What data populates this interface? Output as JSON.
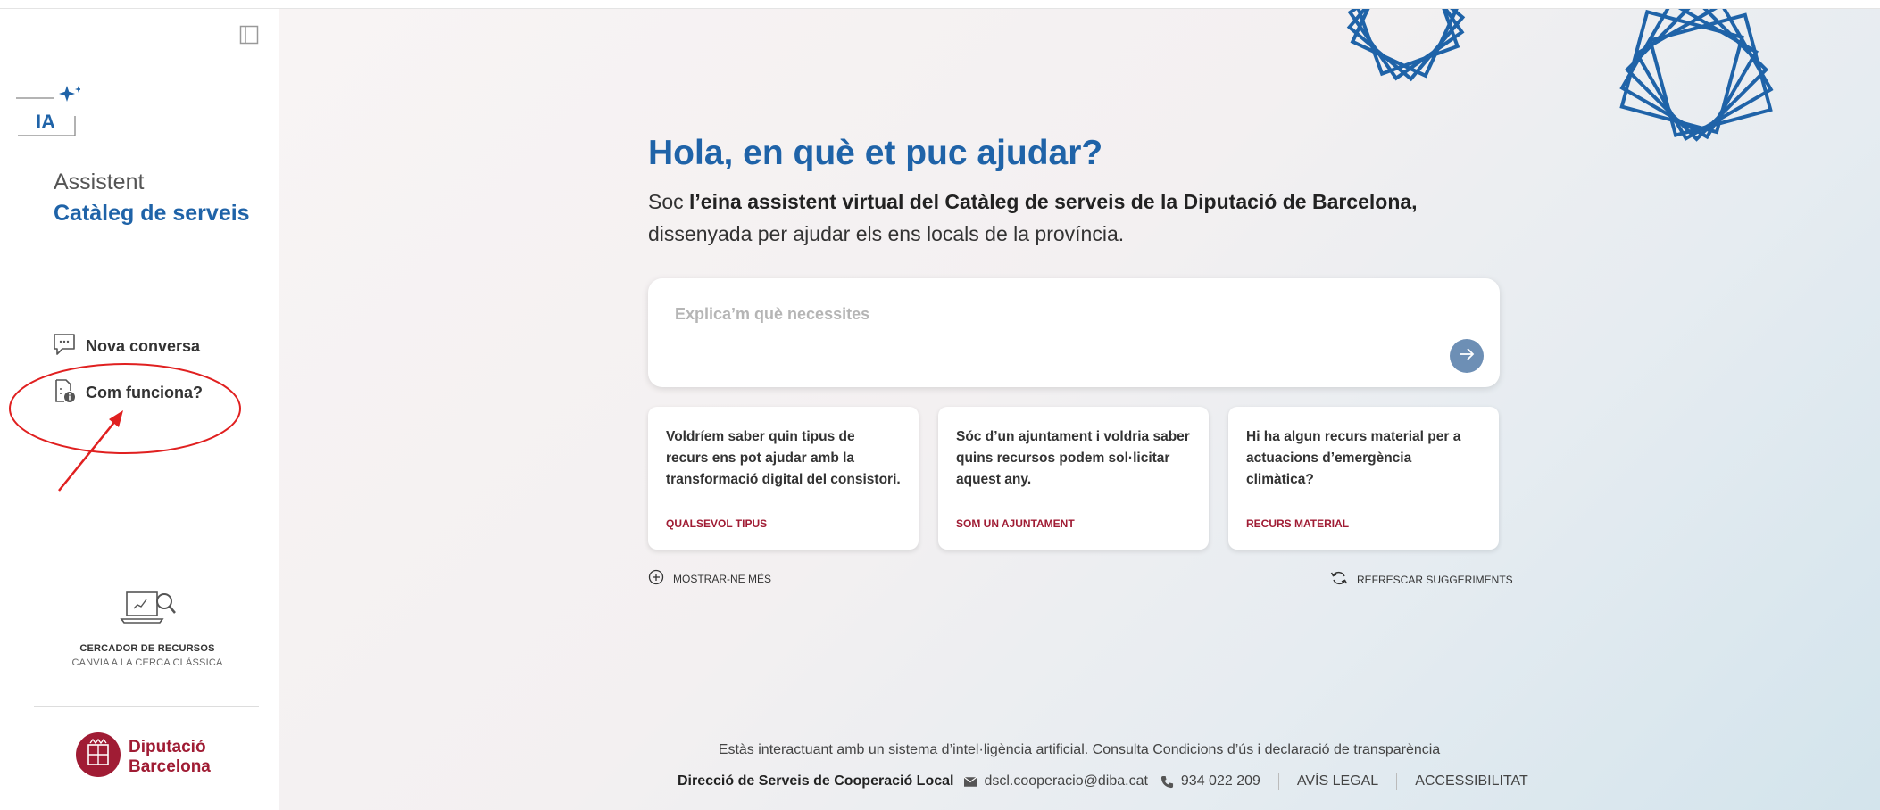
{
  "sidebar": {
    "logo_text": "IA",
    "assistant_label": "Assistent",
    "catalog_label": "Catàleg de serveis",
    "items": [
      {
        "label": "Nova conversa",
        "icon": "chat-bubble-icon"
      },
      {
        "label": "Com funciona?",
        "icon": "document-info-icon"
      }
    ],
    "search_tool": {
      "title": "CERCADOR DE RECURSOS",
      "subtitle": "CANVIA A LA CERCA CLÀSSICA",
      "icon": "laptop-search-icon"
    },
    "org_logo": {
      "line1": "Diputació",
      "line2": "Barcelona"
    }
  },
  "hero": {
    "title": "Hola, en què et puc ajudar?",
    "subtitle_prefix": "Soc ",
    "subtitle_bold": "l’eina assistent virtual del Catàleg de serveis de la Diputació de Barcelona,",
    "subtitle_rest": "dissenyada per ajudar els ens locals de la província."
  },
  "chat": {
    "placeholder": "Explica’m què necessites",
    "send_icon": "arrow-right-icon"
  },
  "suggestions": [
    {
      "question": "Voldríem saber quin tipus de recurs ens pot ajudar amb la transformació digital del consistori.",
      "tag": "QUALSEVOL TIPUS"
    },
    {
      "question": "Sóc d’un ajuntament i voldria saber quins recursos podem sol·licitar aquest any.",
      "tag": "SOM UN AJUNTAMENT"
    },
    {
      "question": "Hi ha algun recurs material per a actuacions d’emergència climàtica?",
      "tag": "RECURS MATERIAL"
    }
  ],
  "actions": {
    "show_more": "MOSTRAR-NE MÉS",
    "refresh": "REFRESCAR SUGGERIMENTS"
  },
  "footer": {
    "notice": "Estàs interactuant amb un sistema d’intel·ligència artificial. Consulta Condicions d’ús i declaració de transparència",
    "org": "Direcció de Serveis de Cooperació Local",
    "email": "dscl.cooperacio@diba.cat",
    "phone": "934 022 209",
    "legal": "AVÍS LEGAL",
    "accessibility": "ACCESSIBILITAT"
  },
  "colors": {
    "brand_blue": "#1f63a8",
    "brand_red": "#a01c34",
    "annotation_red": "#e02020"
  }
}
